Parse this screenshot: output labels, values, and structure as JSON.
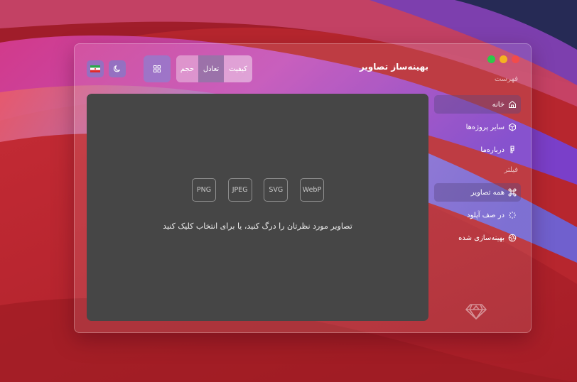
{
  "window": {
    "title": "بهینه‌ساز تصاویر"
  },
  "toolbar": {
    "segments": {
      "size": "حجم",
      "balance": "تعادل",
      "quality": "کیفیت"
    },
    "grid_icon": "grid-icon",
    "theme_icon": "moon-icon",
    "language_icon": "iran-flag-icon"
  },
  "dropzone": {
    "formats": [
      "PNG",
      "JPEG",
      "SVG",
      "WebP"
    ],
    "text": "تصاویر مورد نظرتان را درگ کنید، یا برای انتخاب کلیک کنید"
  },
  "sidebar": {
    "menu_heading": "فهرست",
    "menu_items": [
      {
        "label": "خانه",
        "icon": "home-icon"
      },
      {
        "label": "سایر پروژه‌ها",
        "icon": "box-icon"
      },
      {
        "label": "درباره‌ما",
        "icon": "figma-icon"
      }
    ],
    "filter_heading": "فیلتر",
    "filter_items": [
      {
        "label": "همه تصاویر",
        "icon": "command-icon"
      },
      {
        "label": "در صف آپلود",
        "icon": "loader-icon"
      },
      {
        "label": "بهینه‌سازی شده",
        "icon": "aperture-icon"
      }
    ]
  },
  "colors": {
    "dropzone_bg": "#464646",
    "traffic_red": "#f24b4b",
    "traffic_yellow": "#f5b321",
    "traffic_green": "#2ec84a"
  }
}
